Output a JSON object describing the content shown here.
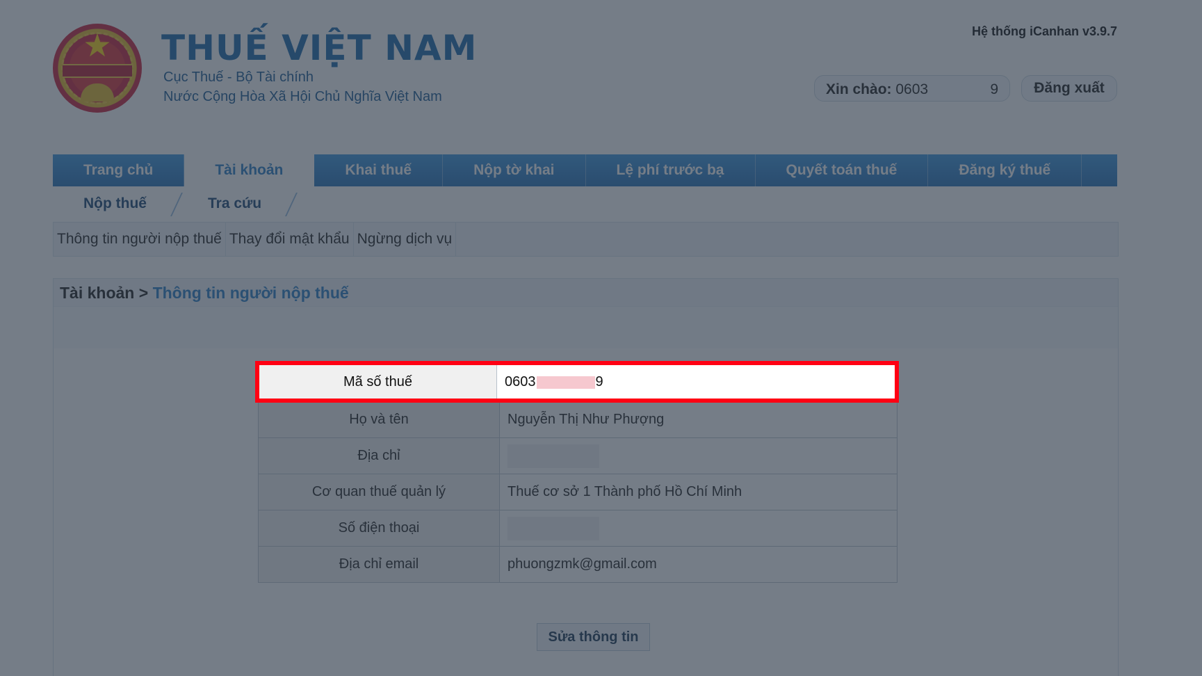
{
  "header": {
    "brand_title": "THUẾ VIỆT NAM",
    "brand_sub1": "Cục Thuế - Bộ Tài chính",
    "brand_sub2": "Nước Cộng Hòa Xã Hội Chủ Nghĩa Việt Nam",
    "emblem_text": "THUẾ NHÀ NƯỚC",
    "system_version": "Hệ thống iCanhan v3.9.7",
    "greeting_label": "Xin chào:",
    "greeting_user_prefix": "0603",
    "greeting_user_suffix": "9",
    "logout_label": "Đăng xuất"
  },
  "main_nav": {
    "items": [
      "Trang chủ",
      "Tài khoản",
      "Khai thuế",
      "Nộp tờ khai",
      "Lệ phí trước bạ",
      "Quyết toán thuế",
      "Đăng ký thuế"
    ],
    "active": "Tài khoản"
  },
  "sub_nav": {
    "items": [
      "Nộp thuế",
      "Tra cứu"
    ]
  },
  "tab_bar": {
    "items": [
      "Thông tin người nộp thuế",
      "Thay đổi mật khẩu",
      "Ngừng dịch vụ"
    ]
  },
  "breadcrumb": {
    "root": "Tài khoản",
    "separator": ">",
    "current": "Thông tin người nộp thuế"
  },
  "info": {
    "tax_code_label": "Mã số thuế",
    "tax_code_prefix": "0603",
    "tax_code_suffix": "9",
    "name_label": "Họ và tên",
    "name_value": "Nguyễn Thị Như Phượng",
    "address_label": "Địa chỉ",
    "tax_office_label": "Cơ quan thuế quản lý",
    "tax_office_value": "Thuế cơ sở 1 Thành phố Hồ Chí Minh",
    "phone_label": "Số điện thoại",
    "email_label": "Địa chỉ email",
    "email_value": "phuongzmk@gmail.com"
  },
  "actions": {
    "edit_label": "Sửa thông tin"
  },
  "colors": {
    "brand_blue": "#0a5da4",
    "nav_blue": "#1768b3",
    "highlight": "#ff0013",
    "overlay": "#34404e"
  }
}
